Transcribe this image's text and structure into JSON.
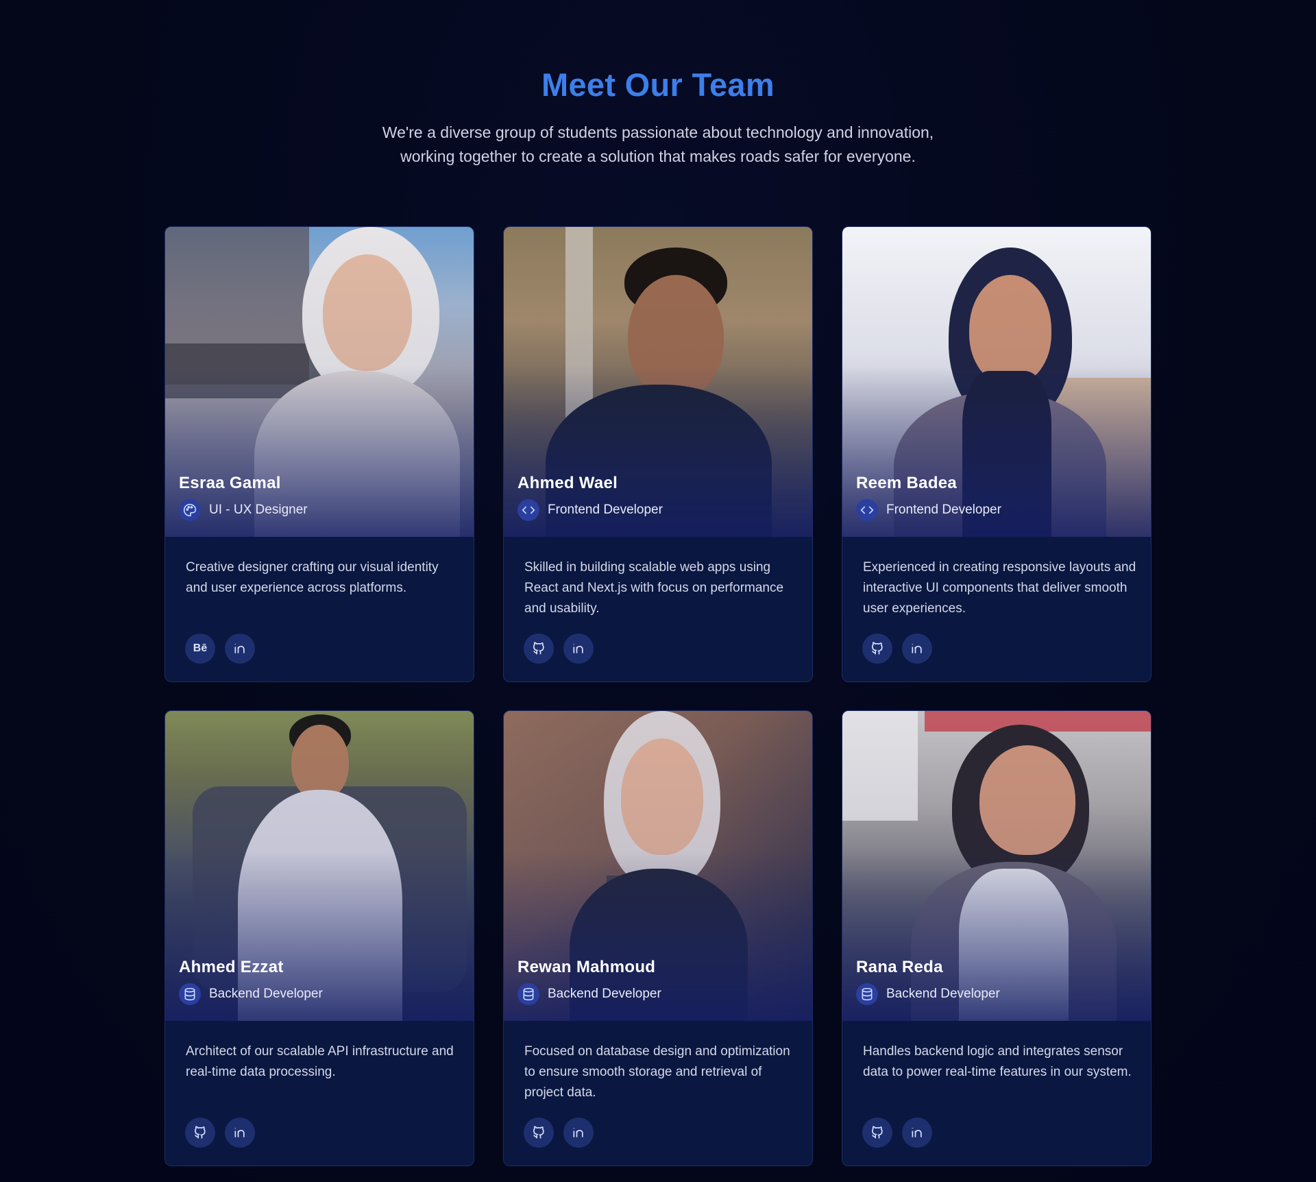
{
  "header": {
    "title": "Meet Our Team",
    "subtitle_line1": "We're a diverse group of students passionate about technology and innovation,",
    "subtitle_line2": "working together to create a solution that makes roads safer for everyone."
  },
  "members": [
    {
      "name": "Esraa Gamal",
      "role": "UI - UX Designer",
      "role_icon": "palette-icon",
      "description": "Creative designer crafting our visual identity and user experience across platforms.",
      "socials": [
        "behance-icon",
        "linkedin-icon"
      ],
      "behance_label": "Bē"
    },
    {
      "name": "Ahmed Wael",
      "role": "Frontend Developer",
      "role_icon": "code-icon",
      "description": "Skilled in building scalable web apps using React and Next.js with focus on performance and usability.",
      "socials": [
        "github-icon",
        "linkedin-icon"
      ]
    },
    {
      "name": "Reem Badea",
      "role": "Frontend Developer",
      "role_icon": "code-icon",
      "description": "Experienced in creating responsive layouts and interactive UI components that deliver smooth user experiences.",
      "socials": [
        "github-icon",
        "linkedin-icon"
      ]
    },
    {
      "name": "Ahmed Ezzat",
      "role": "Backend Developer",
      "role_icon": "database-icon",
      "description": "Architect of our scalable API infrastructure and real-time data processing.",
      "socials": [
        "github-icon",
        "linkedin-icon"
      ]
    },
    {
      "name": "Rewan Mahmoud",
      "role": "Backend Developer",
      "role_icon": "database-icon",
      "description": "Focused on database design and optimization to ensure smooth storage and retrieval of project data.",
      "socials": [
        "github-icon",
        "linkedin-icon"
      ]
    },
    {
      "name": "Rana Reda",
      "role": "Backend Developer",
      "role_icon": "database-icon",
      "description": "Handles backend logic and integrates sensor data to power real-time features in our system.",
      "socials": [
        "github-icon",
        "linkedin-icon"
      ]
    }
  ],
  "colors": {
    "background": "#04071a",
    "title": "#3d7fea",
    "card": "#0a1740",
    "card_border": "#1d2d66",
    "social_bg": "#1d2f6e",
    "role_icon_bg": "#2a3f9e"
  }
}
